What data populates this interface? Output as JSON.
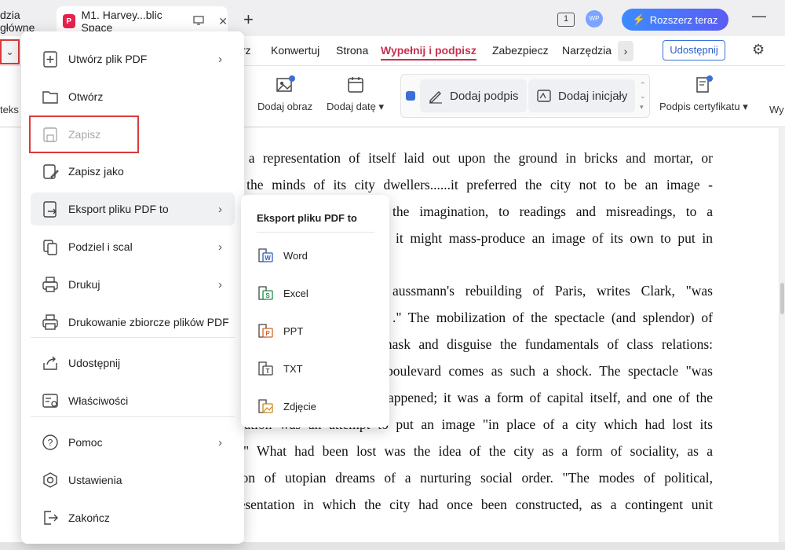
{
  "tabs": {
    "home": "dzia główne",
    "doc": "M1. Harvey...blic Space"
  },
  "topbar": {
    "page_indicator": "1",
    "avatar": "WP",
    "expand_label": "Rozszerz teraz"
  },
  "menubar": {
    "tabs": [
      "arz",
      "Konwertuj",
      "Strona",
      "Wypełnij i podpisz",
      "Zabezpiecz",
      "Narzędzia"
    ],
    "active_tab": "Wypełnij i podpisz",
    "share_label": "Udostępnij"
  },
  "toolbar": {
    "cut_left": "teks",
    "add_image": "Dodaj obraz",
    "add_date": "Dodaj datę",
    "add_signature": "Dodaj podpis",
    "add_initials": "Dodaj inicjały",
    "cert_signature": "Podpis certyfikatu",
    "cut_right": "Wy"
  },
  "file_menu": {
    "items": [
      {
        "label": "Utwórz plik PDF",
        "icon": "create-pdf-icon",
        "has_submenu": true
      },
      {
        "label": "Otwórz",
        "icon": "folder-icon",
        "has_submenu": false
      },
      {
        "label": "Zapisz",
        "icon": "save-icon",
        "has_submenu": false,
        "disabled": true
      },
      {
        "label": "Zapisz jako",
        "icon": "save-as-icon",
        "has_submenu": false
      },
      {
        "label": "Eksport pliku PDF to",
        "icon": "export-icon",
        "has_submenu": true
      },
      {
        "label": "Podziel i scal",
        "icon": "split-merge-icon",
        "has_submenu": true
      },
      {
        "label": "Drukuj",
        "icon": "print-icon",
        "has_submenu": true
      },
      {
        "label": "Drukowanie zbiorcze plików PDF",
        "icon": "batch-print-icon",
        "has_submenu": false
      },
      {
        "label": "Udostępnij",
        "icon": "share-icon",
        "has_submenu": false
      },
      {
        "label": "Właściwości",
        "icon": "properties-icon",
        "has_submenu": false
      },
      {
        "label": "Pomoc",
        "icon": "help-icon",
        "has_submenu": true
      },
      {
        "label": "Ustawienia",
        "icon": "settings-icon",
        "has_submenu": false
      },
      {
        "label": "Zakończ",
        "icon": "exit-icon",
        "has_submenu": false
      }
    ]
  },
  "export_submenu": {
    "title": "Eksport pliku PDF to",
    "items": [
      "Word",
      "Excel",
      "PPT",
      "TXT",
      "Zdjęcie"
    ]
  },
  "document": {
    "lines": [
      "ve a representation of itself laid out upon the ground in bricks and mortar, or",
      "in the minds of its city dwellers......it preferred the city not to be an image -",
      "the imagination, to readings and misreadings, to a",
      "it might mass-produce an image of its own to put in",
      "",
      "aussmann's rebuilding of Paris, writes Clark, \"was",
      ".\" The mobilization of the spectacle (and splendor) of",
      "mask and disguise the fundamentals of class relations:",
      "boulevard comes as such a shock.  The spectacle \"was",
      "appened; it was a form of capital itself, and one of the",
      "nization was an attempt to put an image \"in place of a city which had lost its",
      "\"  What had been lost was the idea of the city as a form of sociality, as a",
      "ction of utopian dreams of a nurturing social order. \"The modes of political,",
      "presentation in which the city had once been constructed, as a contingent unit"
    ]
  }
}
